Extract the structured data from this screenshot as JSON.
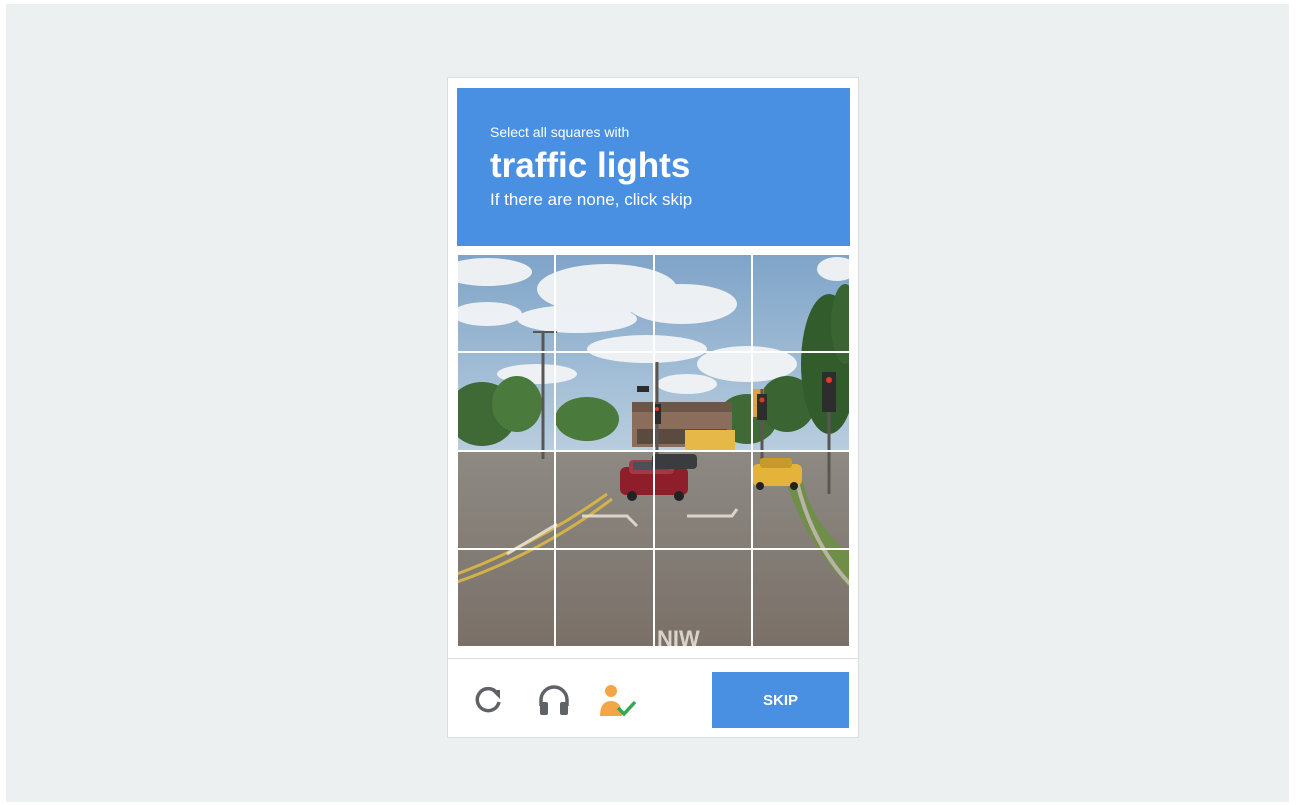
{
  "challenge": {
    "instruction": "Select all squares with",
    "target": "traffic lights",
    "hint": "If there are none, click skip"
  },
  "grid": {
    "rows": 4,
    "columns": 4
  },
  "scene": {
    "sign": "NIW"
  },
  "footer": {
    "icons": [
      "reload-icon",
      "audio-icon",
      "info-icon"
    ],
    "skip_label": "SKIP"
  },
  "colors": {
    "accent": "#4a90e2",
    "background": "#edf0f0",
    "info_person": "#f5a547",
    "info_check": "#34a853"
  }
}
